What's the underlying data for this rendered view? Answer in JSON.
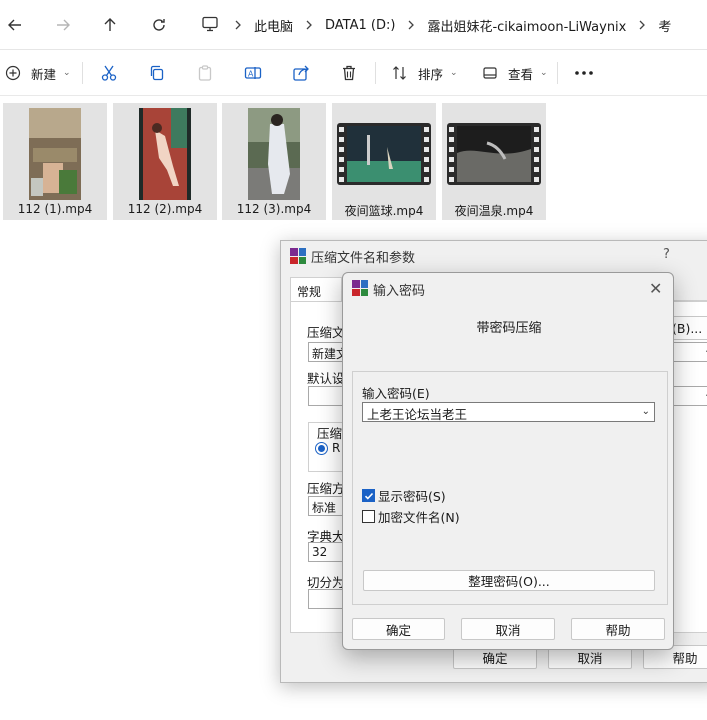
{
  "explorer": {
    "breadcrumbs": [
      "此电脑",
      "DATA1 (D:)",
      "露出姐妹花-cikaimoon-LiWaynix",
      "考"
    ],
    "toolbar": {
      "new_label": "新建",
      "sort_label": "排序",
      "view_label": "查看"
    },
    "files": [
      {
        "name": "112 (1).mp4"
      },
      {
        "name": "112 (2).mp4"
      },
      {
        "name": "112 (3).mp4"
      },
      {
        "name": "夜间篮球.mp4"
      },
      {
        "name": "夜间温泉.mp4"
      }
    ]
  },
  "archive_dialog": {
    "title": "压缩文件名和参数",
    "help_glyph": "?",
    "tab_general": "常规",
    "archive_name_label": "压缩文",
    "archive_name_value": "新建文",
    "browse_fragment": "(B)...",
    "default_profile_label": "默认设",
    "format_group_label": "压缩",
    "format_radio_fragment": "R",
    "method_label": "压缩方",
    "method_value": "标准",
    "dict_label": "字典大",
    "dict_value": "32",
    "split_label": "切分为",
    "ok": "确定",
    "cancel": "取消",
    "help": "帮助"
  },
  "password_dialog": {
    "title": "输入密码",
    "close_glyph": "✕",
    "heading": "带密码压缩",
    "password_label": "输入密码(E)",
    "password_value": "上老王论坛当老王",
    "show_password_label": "显示密码(S)",
    "show_password_checked": true,
    "encrypt_names_label": "加密文件名(N)",
    "encrypt_names_checked": false,
    "organize_button": "整理密码(O)...",
    "ok": "确定",
    "cancel": "取消",
    "help": "帮助"
  },
  "colors": {
    "accent": "#1b62c6",
    "tile_selected_bg": "#e3e3e3",
    "dialog_bg": "#f0f0f0"
  }
}
